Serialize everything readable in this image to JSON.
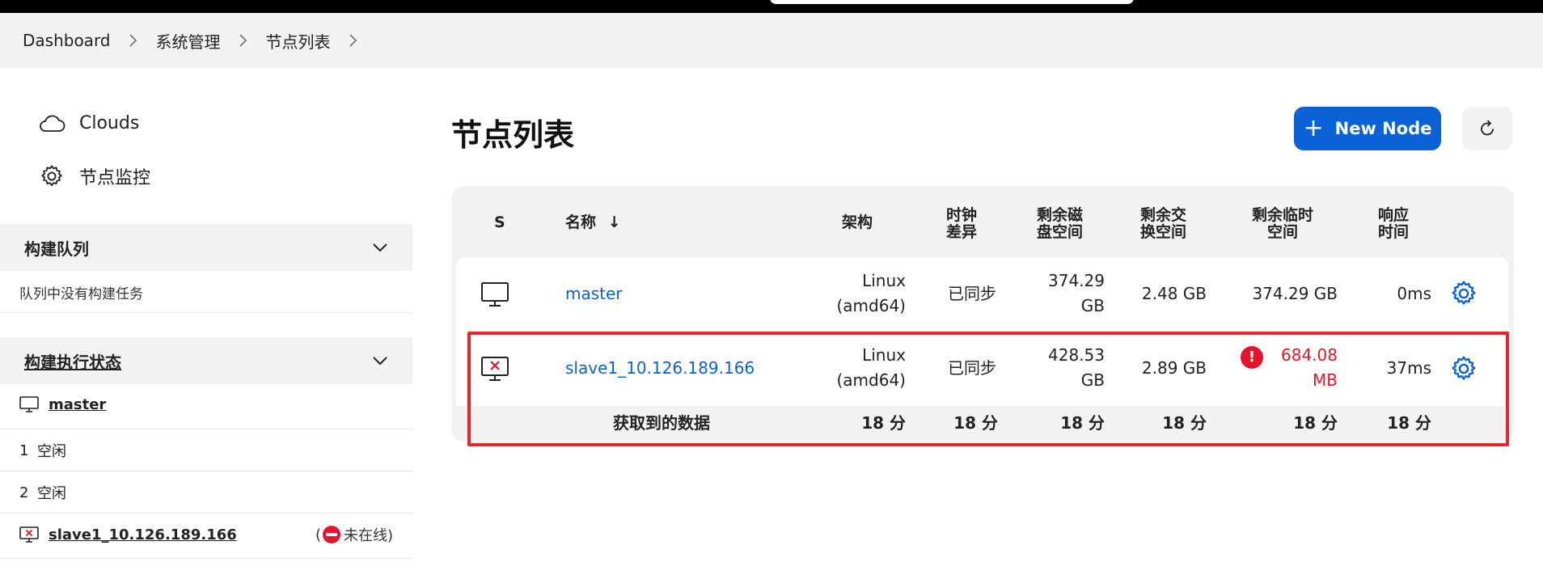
{
  "breadcrumb": {
    "items": [
      "Dashboard",
      "系统管理",
      "节点列表"
    ]
  },
  "sidebar": {
    "links": [
      {
        "label": "Clouds",
        "icon": "cloud-icon"
      },
      {
        "label": "节点监控",
        "icon": "gear-icon"
      }
    ],
    "build_queue": {
      "title": "构建队列",
      "empty_text": "队列中没有构建任务"
    },
    "executor_status": {
      "title": "构建执行状态",
      "nodes": [
        {
          "name": "master",
          "icon": "computer-icon",
          "executors": [
            {
              "number": "1",
              "state": "空闲"
            },
            {
              "number": "2",
              "state": "空闲"
            }
          ]
        },
        {
          "name": "slave1_10.126.189.166",
          "icon": "computer-offline-icon",
          "status_open": "(",
          "status_text": "未在线)"
        }
      ]
    }
  },
  "main": {
    "title": "节点列表",
    "new_node_label": "New Node",
    "accent_color": "#0b62d6",
    "table": {
      "headers": {
        "s": "S",
        "name": "名称",
        "sort_arrow": "↓",
        "arch": "架构",
        "clock_1": "时钟",
        "clock_2": "差异",
        "disk_1": "剩余磁",
        "disk_2": "盘空间",
        "swap_1": "剩余交",
        "swap_2": "换空间",
        "tmp_1": "剩余临时",
        "tmp_2": "空间",
        "resp_1": "响应",
        "resp_2": "时间"
      },
      "rows": [
        {
          "name": "master",
          "icon": "computer-icon",
          "arch_1": "Linux",
          "arch_2": "(amd64)",
          "clock": "已同步",
          "disk_1": "374.29",
          "disk_2": "GB",
          "swap": "2.48 GB",
          "tmp": "374.29 GB",
          "resp": "0ms"
        },
        {
          "name": "slave1_10.126.189.166",
          "icon": "computer-offline-icon",
          "arch_1": "Linux",
          "arch_2": "(amd64)",
          "clock": "已同步",
          "disk_1": "428.53",
          "disk_2": "GB",
          "swap": "2.89 GB",
          "tmp_1": "684.08",
          "tmp_2": "MB",
          "tmp_warning": "!",
          "resp": "37ms"
        }
      ],
      "footer": {
        "label": "获取到的数据",
        "arch": "18 分",
        "clock": "18 分",
        "disk": "18 分",
        "swap": "18 分",
        "tmp": "18 分",
        "resp": "18 分"
      }
    }
  }
}
